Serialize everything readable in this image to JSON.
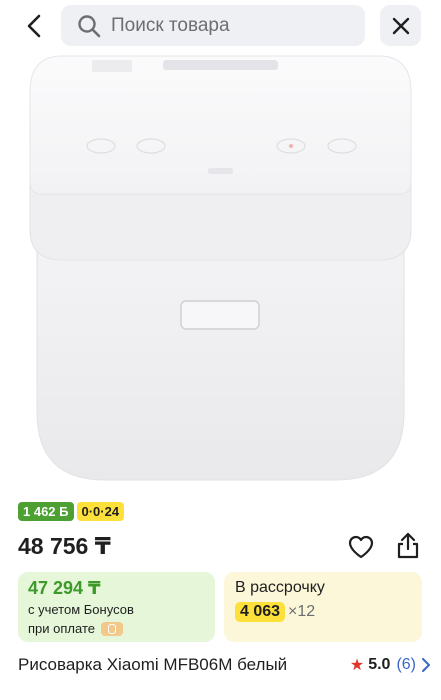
{
  "search": {
    "placeholder": "Поиск товара"
  },
  "badges": {
    "green": "1 462 Б",
    "yellow": "0·0·24"
  },
  "product": {
    "price": "48 756 ₸",
    "title": "Рисоварка Xiaomi MFB06M белый",
    "rating": "5.0",
    "reviews": "(6)"
  },
  "bonus": {
    "price": "47 294 ₸",
    "line1": "с учетом Бонусов",
    "line2": "при оплате"
  },
  "installment": {
    "title": "В рассрочку",
    "amount": "4 063",
    "times": "×12"
  },
  "icons": {
    "back": "back-arrow-icon",
    "search": "search-icon",
    "close": "close-icon",
    "favorite": "heart-icon",
    "share": "share-icon",
    "star": "star-icon",
    "chevron": "chevron-right-icon"
  },
  "colors": {
    "green_badge": "#4da032",
    "yellow_badge": "#fde13a",
    "bonus_bg": "#e6f6d9",
    "bonus_text": "#3d9a2a",
    "installment_bg": "#fcf7d8",
    "star": "#e0352b",
    "link": "#3a67c9"
  }
}
